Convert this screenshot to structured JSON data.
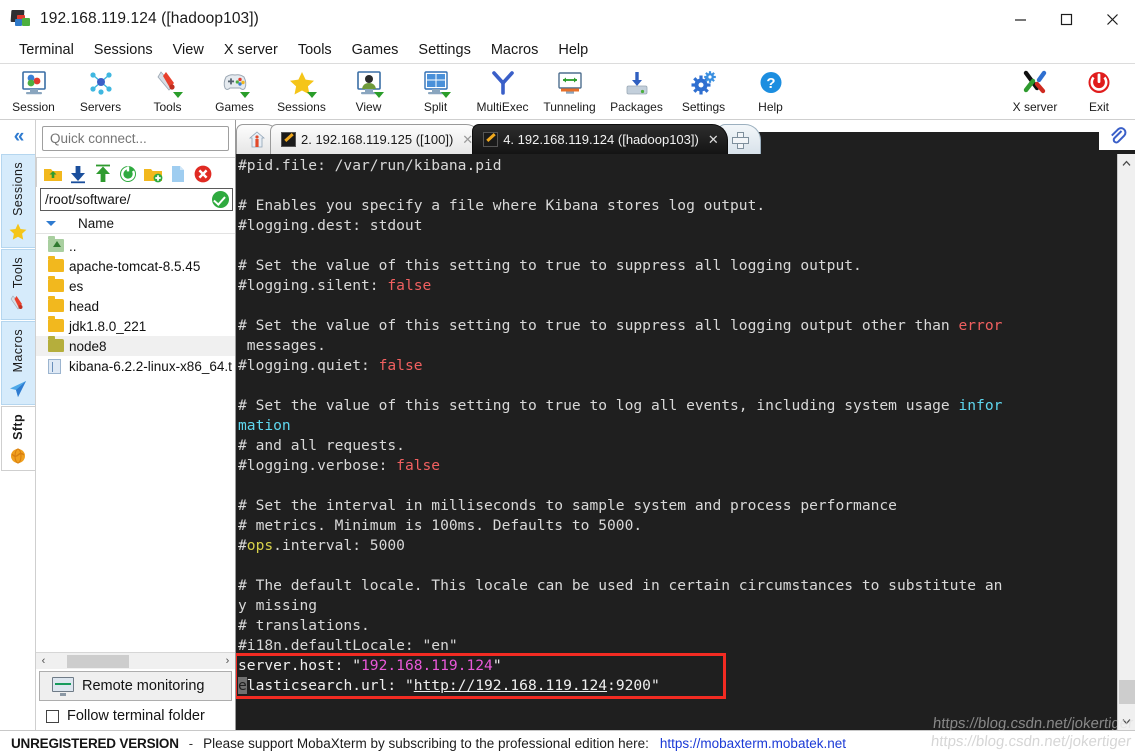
{
  "window": {
    "title": "192.168.119.124 ([hadoop103])",
    "minimize_label": "—",
    "maximize_label": "□",
    "close_label": "✕"
  },
  "menubar": {
    "items": [
      {
        "label": "Terminal"
      },
      {
        "label": "Sessions"
      },
      {
        "label": "View"
      },
      {
        "label": "X server"
      },
      {
        "label": "Tools"
      },
      {
        "label": "Games"
      },
      {
        "label": "Settings"
      },
      {
        "label": "Macros"
      },
      {
        "label": "Help"
      }
    ]
  },
  "toolbar": {
    "items": [
      {
        "label": "Session",
        "icon": "session-icon"
      },
      {
        "label": "Servers",
        "icon": "servers-icon"
      },
      {
        "label": "Tools",
        "icon": "tools-icon"
      },
      {
        "label": "Games",
        "icon": "games-icon"
      },
      {
        "label": "Sessions",
        "icon": "sessions-star-icon"
      },
      {
        "label": "View",
        "icon": "view-icon"
      },
      {
        "label": "Split",
        "icon": "split-icon"
      },
      {
        "label": "MultiExec",
        "icon": "multiexec-icon"
      },
      {
        "label": "Tunneling",
        "icon": "tunneling-icon"
      },
      {
        "label": "Packages",
        "icon": "packages-icon"
      },
      {
        "label": "Settings",
        "icon": "settings-gear-icon"
      },
      {
        "label": "Help",
        "icon": "help-icon"
      }
    ],
    "right_items": [
      {
        "label": "X server",
        "icon": "x-server-icon"
      },
      {
        "label": "Exit",
        "icon": "exit-power-icon"
      }
    ]
  },
  "sidebar": {
    "collapse_label": "«",
    "vtabs": [
      {
        "label": "Sessions",
        "icon": "star-icon",
        "active": false
      },
      {
        "label": "Tools",
        "icon": "tools-icon",
        "active": false
      },
      {
        "label": "Macros",
        "icon": "macro-icon",
        "active": false
      },
      {
        "label": "Sftp",
        "icon": "globe-icon",
        "active": true
      }
    ]
  },
  "sftp": {
    "quick_connect_placeholder": "Quick connect...",
    "toolbar_icons": [
      "upload-parent-folder-icon",
      "download-icon",
      "upload-icon",
      "refresh-icon",
      "new-folder-icon",
      "new-file-icon",
      "delete-icon"
    ],
    "path": "/root/software/",
    "column_header": "Name",
    "files": [
      {
        "name": "..",
        "type": "up",
        "selected": false
      },
      {
        "name": "apache-tomcat-8.5.45",
        "type": "folder",
        "selected": false
      },
      {
        "name": "es",
        "type": "folder",
        "selected": false
      },
      {
        "name": "head",
        "type": "folder",
        "selected": false
      },
      {
        "name": "jdk1.8.0_221",
        "type": "folder",
        "selected": false
      },
      {
        "name": "node8",
        "type": "folder-olive",
        "selected": true
      },
      {
        "name": "kibana-6.2.2-linux-x86_64.t",
        "type": "file",
        "selected": false
      }
    ],
    "hscroll_left": "‹",
    "hscroll_right": "›",
    "remote_monitoring_label": "Remote monitoring",
    "follow_terminal_label": "Follow terminal folder"
  },
  "tabs": {
    "home_icon": "home-icon",
    "items": [
      {
        "label": "2. 192.168.119.125 ([100])",
        "active": false,
        "close": "✕"
      },
      {
        "label": "4. 192.168.119.124 ([hadoop103])",
        "active": true,
        "close": "✕"
      }
    ],
    "new_tab_icon": "plus-icon",
    "clip_icon": "paperclip-icon"
  },
  "terminal": {
    "lines": [
      [
        {
          "t": "#pid.file: /var/run/kibana.pid",
          "c": "cmt"
        }
      ],
      [
        {
          "t": "",
          "c": "cmt"
        }
      ],
      [
        {
          "t": "# Enables you specify a file where Kibana stores log output.",
          "c": "cmt"
        }
      ],
      [
        {
          "t": "#logging.dest: stdout",
          "c": "cmt"
        }
      ],
      [
        {
          "t": "",
          "c": "cmt"
        }
      ],
      [
        {
          "t": "# Set the value of this setting to true to suppress all logging output.",
          "c": "cmt"
        }
      ],
      [
        {
          "t": "#logging.silent: ",
          "c": "cmt"
        },
        {
          "t": "false",
          "c": "red"
        }
      ],
      [
        {
          "t": "",
          "c": "cmt"
        }
      ],
      [
        {
          "t": "# Set the value of this setting to true to suppress all logging output other than ",
          "c": "cmt"
        },
        {
          "t": "error",
          "c": "red"
        }
      ],
      [
        {
          "t": " messages.",
          "c": "cmt"
        }
      ],
      [
        {
          "t": "#logging.quiet: ",
          "c": "cmt"
        },
        {
          "t": "false",
          "c": "red"
        }
      ],
      [
        {
          "t": "",
          "c": "cmt"
        }
      ],
      [
        {
          "t": "# Set the value of this setting to true to log all events, including system usage ",
          "c": "cmt"
        },
        {
          "t": "infor",
          "c": "cyan"
        }
      ],
      [
        {
          "t": "mation",
          "c": "cyan"
        }
      ],
      [
        {
          "t": "# and all requests.",
          "c": "cmt"
        }
      ],
      [
        {
          "t": "#logging.verbose: ",
          "c": "cmt"
        },
        {
          "t": "false",
          "c": "red"
        }
      ],
      [
        {
          "t": "",
          "c": "cmt"
        }
      ],
      [
        {
          "t": "# Set the interval in milliseconds to sample system and process performance",
          "c": "cmt"
        }
      ],
      [
        {
          "t": "# metrics. Minimum is 100ms. Defaults to 5000.",
          "c": "cmt"
        }
      ],
      [
        {
          "t": "#",
          "c": "cmt"
        },
        {
          "t": "ops",
          "c": "yellow"
        },
        {
          "t": ".interval: 5000",
          "c": "cmt"
        }
      ],
      [
        {
          "t": "",
          "c": "cmt"
        }
      ],
      [
        {
          "t": "# The default locale. This locale can be used in certain circumstances to substitute an",
          "c": "cmt"
        }
      ],
      [
        {
          "t": "y missing",
          "c": "cmt"
        }
      ],
      [
        {
          "t": "# translations.",
          "c": "cmt"
        }
      ],
      [
        {
          "t": "#i18n.defaultLocale: \"en\"",
          "c": "cmt"
        }
      ]
    ],
    "highlighted_lines": [
      [
        {
          "t": "server.host: \"",
          "c": "white"
        },
        {
          "t": "192.168.119.124",
          "c": "magenta"
        },
        {
          "t": "\"",
          "c": "white"
        }
      ],
      [
        {
          "t": "e",
          "c": "cursor"
        },
        {
          "t": "lasticsearch.url: \"",
          "c": "white"
        },
        {
          "t": "http://192.168.119.124",
          "c": "link"
        },
        {
          "t": ":9200\"",
          "c": "white"
        }
      ]
    ],
    "highlight_color": "#f22b22"
  },
  "statusbar": {
    "unregistered": "UNREGISTERED VERSION",
    "dash": "-",
    "message": "Please support MobaXterm by subscribing to the professional edition here:",
    "link": "https://mobaxterm.mobatek.net",
    "watermark": "https://blog.csdn.net/jokertiger"
  }
}
